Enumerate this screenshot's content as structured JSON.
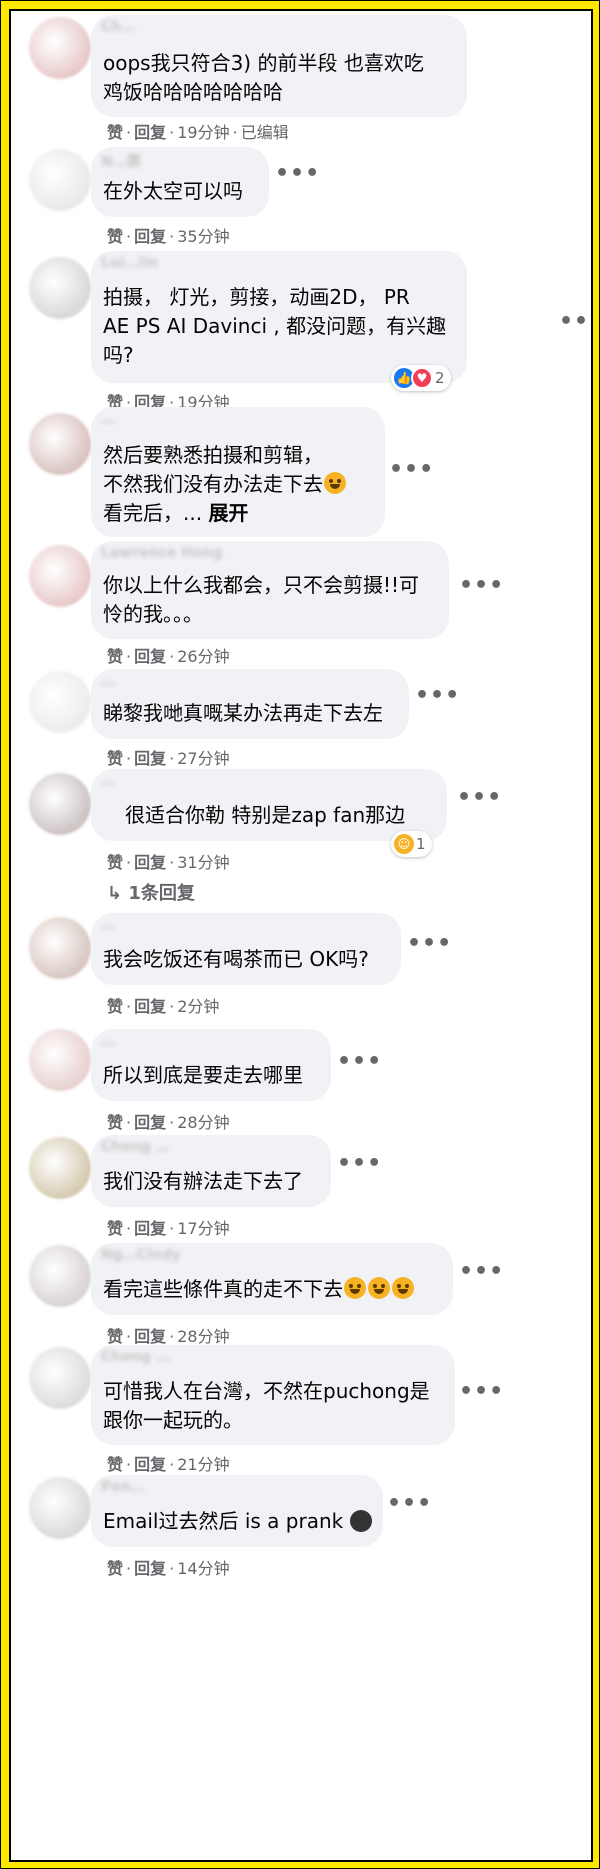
{
  "actions": {
    "like": "赞",
    "reply": "回复",
    "separator": "·"
  },
  "comments": [
    {
      "author": "Ch…",
      "text": "oops我只符合3) 的前半段 也喜欢吃\n鸡饭哈哈哈哈哈哈哈",
      "time": "19分钟",
      "edited": "已编辑",
      "avatar_color": "#e7c9c9"
    },
    {
      "author": "N…霖",
      "text": "在外太空可以吗",
      "time": "35分钟",
      "avatar_color": "#e9e9e9"
    },
    {
      "author": "Lui…lin",
      "text": "拍摄， 灯光，剪接，动画2D， PR\nAE PS AI Davinci , 都没问题，有兴趣\n吗?",
      "time": "19分钟",
      "reaction_count": "2",
      "avatar_color": "#d8d8d8"
    },
    {
      "author": "…",
      "text": "然后要熟悉拍摄和剪辑，\n不然我们没有办法走下去",
      "text_line3": "看完后，... ",
      "more": "展开",
      "avatar_color": "#d9c2bf"
    },
    {
      "author": "Lawrence Hong",
      "text": "你以上什么我都会，只不会剪摄!!可\n怜的我。。。",
      "time": "26分钟",
      "avatar_color": "#e8c9c9"
    },
    {
      "author": "…",
      "text": "睇黎我哋真嘅某办法再走下去左",
      "time": "27分钟",
      "avatar_color": "#ececec"
    },
    {
      "author": "…",
      "text": "很适合你勒 特别是zap fan那边",
      "time": "31分钟",
      "reaction_count": "1",
      "replies": "1条回复",
      "avatar_color": "#ccc3c3"
    },
    {
      "author": "…",
      "text": "我会吃饭还有喝茶而已 OK吗?",
      "time": "2分钟",
      "avatar_color": "#d8c6bf"
    },
    {
      "author": "…",
      "text": "所以到底是要走去哪里",
      "time": "28分钟",
      "avatar_color": "#e8d0d0"
    },
    {
      "author": "Chong …",
      "text": "我们没有辦法走下去了",
      "time": "17分钟",
      "avatar_color": "#d5cab0"
    },
    {
      "author": "Ng…Cindy",
      "text": "看完這些條件真的走不下去",
      "time": "28分钟",
      "avatar_color": "#d9d3d3"
    },
    {
      "author": "Chong …",
      "text": "可惜我人在台灣，不然在puchong是\n跟你一起玩的。",
      "time": "21分钟",
      "avatar_color": "#dcdcdc"
    },
    {
      "author": "Pen…",
      "text": "Email过去然后 is a prank",
      "time": "14分钟",
      "avatar_color": "#d9d9d9"
    }
  ]
}
